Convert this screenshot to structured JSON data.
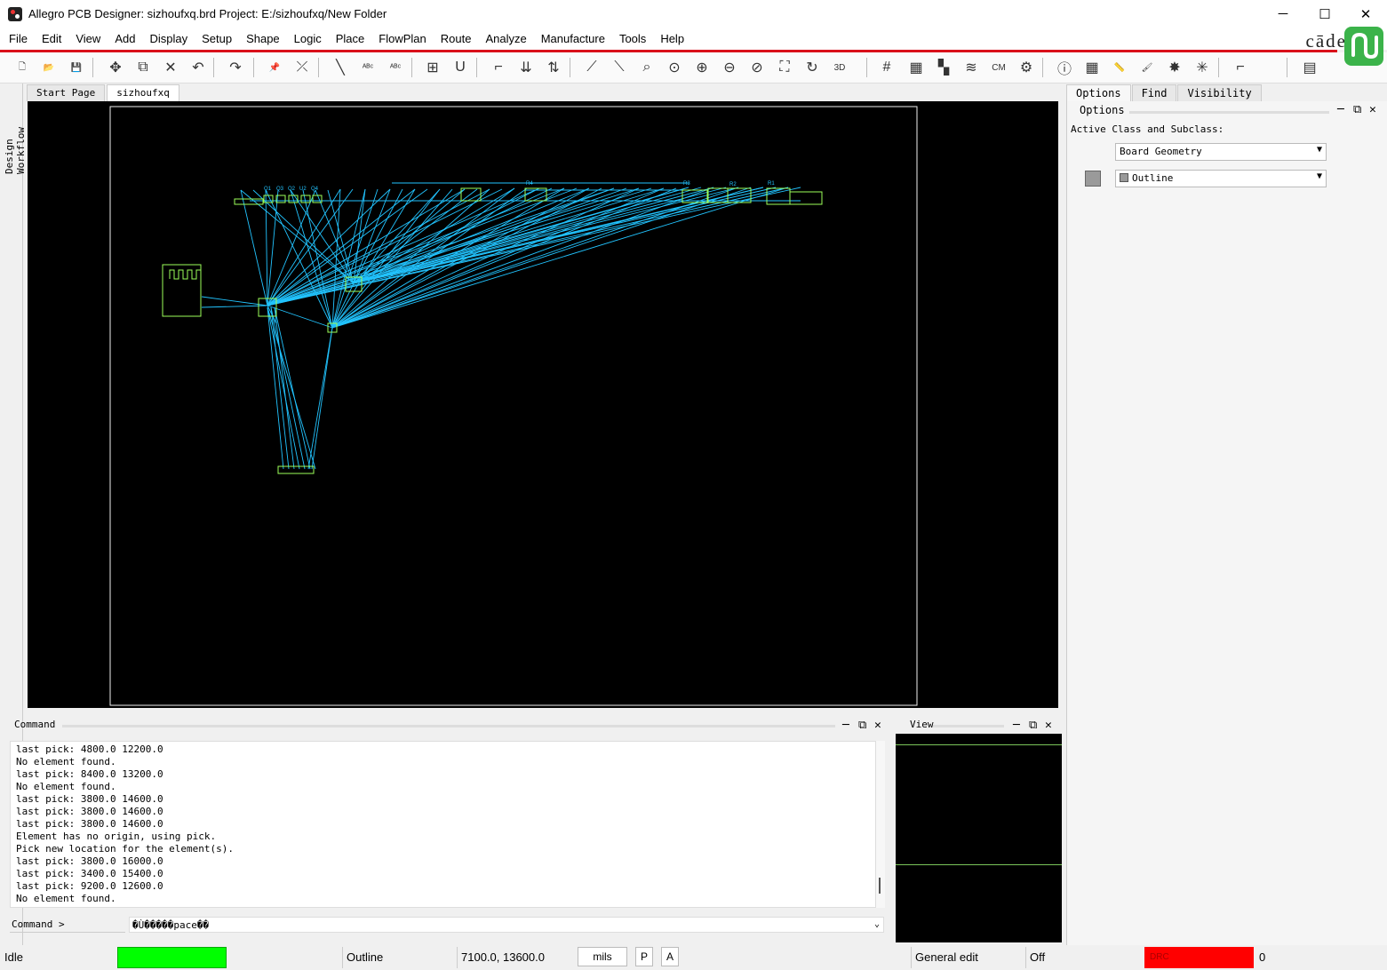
{
  "window": {
    "title": "Allegro PCB Designer: sizhoufxq.brd  Project: E:/sizhoufxq/New Folder",
    "minimize": "─",
    "maximize": "☐",
    "close": "✕"
  },
  "brand": {
    "logo_text": "cāde"
  },
  "menu": [
    "File",
    "Edit",
    "View",
    "Add",
    "Display",
    "Setup",
    "Shape",
    "Logic",
    "Place",
    "FlowPlan",
    "Route",
    "Analyze",
    "Manufacture",
    "Tools",
    "Help"
  ],
  "toolbar": {
    "buttons": [
      {
        "name": "new-icon",
        "glyph": "🗋"
      },
      {
        "name": "open-icon",
        "glyph": "📂"
      },
      {
        "name": "save-icon",
        "glyph": "💾"
      },
      {
        "name": "move-icon",
        "glyph": "✥"
      },
      {
        "name": "copy-icon",
        "glyph": "⧉"
      },
      {
        "name": "delete-icon",
        "glyph": "✕"
      },
      {
        "name": "undo-icon",
        "glyph": "↶"
      },
      {
        "name": "redo-icon",
        "glyph": "↷"
      },
      {
        "name": "pin-icon",
        "glyph": "📌"
      },
      {
        "name": "unpin-icon",
        "glyph": "⤫"
      },
      {
        "name": "add-line-icon",
        "glyph": "╲"
      },
      {
        "name": "add-text-icon",
        "glyph": "ᴬᴮᶜ"
      },
      {
        "name": "edit-text-icon",
        "glyph": "ᴬᴮᶜ"
      },
      {
        "name": "place-component-icon",
        "glyph": "⊞"
      },
      {
        "name": "place-ic-icon",
        "glyph": "U"
      },
      {
        "name": "connect-icon",
        "glyph": "⌐"
      },
      {
        "name": "slide-icon",
        "glyph": "⇊"
      },
      {
        "name": "swap-icon",
        "glyph": "⇅"
      },
      {
        "name": "unrats-icon",
        "glyph": "⟋"
      },
      {
        "name": "rats-icon",
        "glyph": "⟍"
      },
      {
        "name": "zoom-pick-icon",
        "glyph": "⌕"
      },
      {
        "name": "zoom-fit-icon",
        "glyph": "⊙"
      },
      {
        "name": "zoom-in-icon",
        "glyph": "⊕"
      },
      {
        "name": "zoom-out-icon",
        "glyph": "⊖"
      },
      {
        "name": "zoom-prev-icon",
        "glyph": "⊘"
      },
      {
        "name": "zoom-world-icon",
        "glyph": "⛶"
      },
      {
        "name": "redraw-icon",
        "glyph": "↻"
      },
      {
        "name": "3d-view-icon",
        "glyph": "3D"
      },
      {
        "name": "grid-icon",
        "glyph": "#"
      },
      {
        "name": "color-icon",
        "glyph": "▦"
      },
      {
        "name": "visibility-icon",
        "glyph": "▚"
      },
      {
        "name": "layers-icon",
        "glyph": "≋"
      },
      {
        "name": "constraint-manager-icon",
        "glyph": "CM"
      },
      {
        "name": "settings-icon",
        "glyph": "⚙"
      },
      {
        "name": "info-icon",
        "glyph": "ⓘ"
      },
      {
        "name": "show-element-icon",
        "glyph": "▦"
      },
      {
        "name": "measure-icon",
        "glyph": "📏"
      },
      {
        "name": "highlight-icon",
        "glyph": "🖌"
      },
      {
        "name": "dehighlight-icon",
        "glyph": "✸"
      },
      {
        "name": "clear-icon",
        "glyph": "✳"
      },
      {
        "name": "shape-icon",
        "glyph": "⌐"
      },
      {
        "name": "table-icon",
        "glyph": "▤"
      }
    ]
  },
  "left_rail": {
    "label": "Design Workflow"
  },
  "doc_tabs": [
    "Start Page",
    "sizhoufxq"
  ],
  "right_panel": {
    "tabs": [
      "Options",
      "Find",
      "Visibility"
    ],
    "title": "Options",
    "active_label": "Active Class and Subclass:",
    "class_value": "Board Geometry",
    "subclass_value": "Outline",
    "swatch_color": "#9a9a9a"
  },
  "canvas": {
    "background": "#000000",
    "ratsnest_color": "#22c4ff",
    "outline_color": "#f0f0f0",
    "component_color": "#9cff5a",
    "refdes": [
      "Q1",
      "Q3",
      "Q2",
      "U2",
      "Q4",
      "R4",
      "R3",
      "R2",
      "R1"
    ]
  },
  "command": {
    "title": "Command",
    "log": [
      "last pick:  4800.0 12200.0",
      "No element found.",
      "last pick:  8400.0 13200.0",
      "No element found.",
      "last pick:  3800.0 14600.0",
      "last pick:  3800.0 14600.0",
      "last pick:  3800.0 14600.0",
      "Element has no origin, using pick.",
      "Pick new location for the element(s).",
      "last pick:  3800.0 16000.0",
      "last pick:  3400.0 15400.0",
      "last pick:  9200.0 12600.0",
      "No element found."
    ],
    "prompt": "Command >",
    "input_value": "�Ù�����pace��"
  },
  "view": {
    "title": "View"
  },
  "status": {
    "state": "Idle",
    "state_color": "#00ff00",
    "subclass": "Outline",
    "coords": "7100.0, 13600.0",
    "units": "mils",
    "p_btn": "P",
    "a_btn": "A",
    "mode": "General edit",
    "off": "Off",
    "drc_label": "DRC",
    "drc_color": "#ff0000",
    "drc_count": "0"
  }
}
